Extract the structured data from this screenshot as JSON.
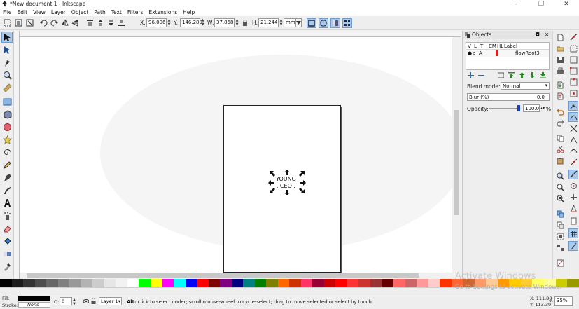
{
  "window": {
    "title": "*New document 1 - Inkscape"
  },
  "menu": [
    "File",
    "Edit",
    "View",
    "Layer",
    "Object",
    "Path",
    "Text",
    "Filters",
    "Extensions",
    "Help"
  ],
  "controls": {
    "x_label": "X:",
    "x_value": "96.006",
    "y_label": "Y:",
    "y_value": "146.289",
    "w_label": "W:",
    "w_value": "37.858",
    "h_label": "H:",
    "h_value": "21.244",
    "unit": "mm"
  },
  "canvas": {
    "text_line1": "YOUNG",
    "text_line2": ". CEO ."
  },
  "objects_panel": {
    "title": "Objects",
    "columns": [
      "V",
      "L",
      "T",
      "CM",
      "HL",
      "Label"
    ],
    "rows": [
      {
        "label": "flowRoot3"
      }
    ],
    "blend_label": "Blend mode:",
    "blend_value": "Normal",
    "blur_label": "Blur (%)",
    "blur_value": "0.0",
    "opacity_label": "Opacity:",
    "opacity_value": "100.0",
    "opacity_unit": "%"
  },
  "status": {
    "fill_label": "Fill:",
    "stroke_label": "Stroke:",
    "stroke_value": "None",
    "o_label": "O:",
    "o_value": "0",
    "layer": "Layer 1",
    "message_bold": "Alt:",
    "message": " click to select under; scroll mouse-wheel to cycle-select; drag to move selected or select by touch",
    "x_coord": "X: 111.88",
    "y_coord": "Y: 113.39",
    "z_label": "Z:",
    "zoom": "35%"
  },
  "watermark": {
    "line1": "Activate Windows",
    "line2": "Go to Settings to activate Windows."
  },
  "palette_colors": [
    "#000000",
    "#1a1a1a",
    "#333333",
    "#4d4d4d",
    "#666666",
    "#808080",
    "#999999",
    "#b3b3b3",
    "#cccccc",
    "#e6e6e6",
    "#f2f2f2",
    "#ffffff",
    "#00ff00",
    "#ffff00",
    "#ff00ff",
    "#00ffff",
    "#0000ff",
    "#ff0000",
    "#800000",
    "#800080",
    "#000080",
    "#008080",
    "#008000",
    "#808000",
    "#ff6600",
    "#cc3300",
    "#ff3366",
    "#990033",
    "#cc0000",
    "#ff0000",
    "#ff3333",
    "#cc3333",
    "#993333",
    "#660000",
    "#ff6666",
    "#cc6666",
    "#ff9999",
    "#ffcccc",
    "#ff3300",
    "#ff6633",
    "#cc6633",
    "#ff9966",
    "#ffcc99",
    "#ff9900",
    "#ffcc00",
    "#ffcc33",
    "#ffff66",
    "#ffff99",
    "#cccc00",
    "#999900"
  ]
}
